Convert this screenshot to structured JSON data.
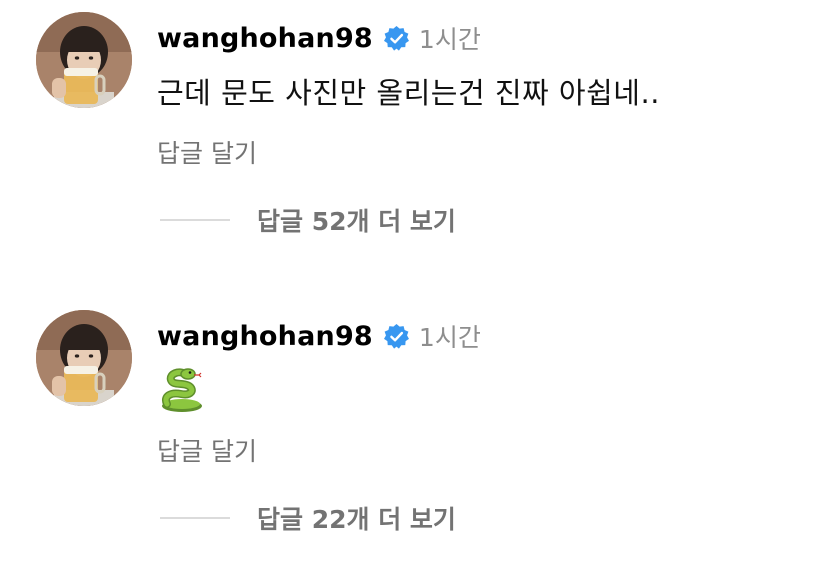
{
  "comments": [
    {
      "username": "wanghohan98",
      "time": "1시간",
      "text": "근데 문도 사진만 올리는건 진짜 아쉽네..",
      "reply_label": "답글 달기",
      "view_replies_label": "답글 52개 더 보기"
    },
    {
      "username": "wanghohan98",
      "time": "1시간",
      "text": "",
      "emoji": "snake-emoji",
      "reply_label": "답글 달기",
      "view_replies_label": "답글 22개 더 보기"
    }
  ],
  "colors": {
    "verified_blue": "#3897f0",
    "muted_text": "#737373",
    "timestamp": "#8e8e8e",
    "divider": "#dbdbdb"
  }
}
